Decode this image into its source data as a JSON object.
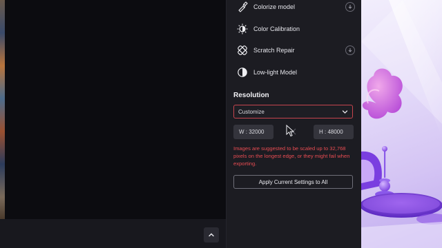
{
  "models": [
    {
      "label": "Colorize model",
      "icon": "paint-brush-icon",
      "downloadable": true
    },
    {
      "label": "Color Calibration",
      "icon": "brightness-icon",
      "downloadable": false
    },
    {
      "label": "Scratch Repair",
      "icon": "bandage-icon",
      "downloadable": true
    },
    {
      "label": "Low-light Model",
      "icon": "contrast-icon",
      "downloadable": false
    }
  ],
  "resolution": {
    "title": "Resolution",
    "mode": "Customize",
    "width_label": "W : 32000",
    "height_label": "H : 48000",
    "warning": "Images are suggested to be scaled up to 32,768 pixels on the longest edge, or they might fail when exporting.",
    "apply_label": "Apply Current Settings to All"
  },
  "colors": {
    "accent_error": "#e84c52",
    "panel_bg": "#1c1c22",
    "canvas_bg": "#0c0c10"
  }
}
